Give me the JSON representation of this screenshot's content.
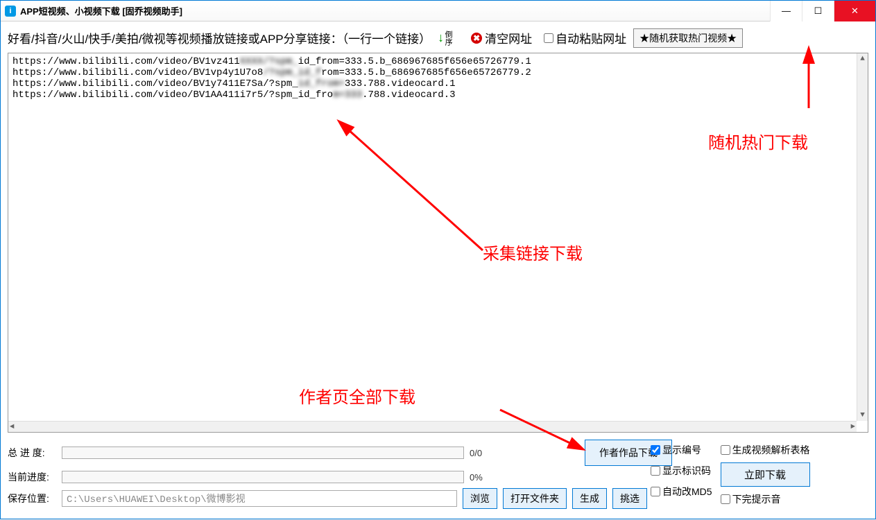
{
  "window": {
    "title": "APP短视频、小视频下载 [固乔视频助手]",
    "icon_letter": "i"
  },
  "toolbar": {
    "instruction": "好看/抖音/火山/快手/美拍/微视等视频播放链接或APP分享链接：（一行一个链接）",
    "reverse_label": "倒序",
    "clear_label": "清空网址",
    "auto_paste_label": "自动粘贴网址",
    "random_hot_label": "★随机获取热门视频★"
  },
  "urls": {
    "line1a": "https://www.bilibili.com/video/BV1vz411",
    "line1b": "id_from=333.5.b_686967685f656e65726779.1",
    "line2a": "https://www.bilibili.com/video/BV1vp4y1U7o8",
    "line2b": "rom=333.5.b_686967685f656e65726779.2",
    "line3a": "https://www.bilibili.com/video/BV1y7411E7Sa/?spm_",
    "line3b": "333.788.videocard.1",
    "line4a": "https://www.bilibili.com/video/BV1AA411i7r5/?spm_id_fro",
    "line4b": ".788.videocard.3"
  },
  "progress": {
    "total_label": "总 进 度:",
    "total_text": "0/0",
    "current_label": "当前进度:",
    "current_text": "0%"
  },
  "save": {
    "label": "保存位置:",
    "path": "C:\\Users\\HUAWEI\\Desktop\\微博影视",
    "browse": "浏览",
    "open_folder": "打开文件夹",
    "generate": "生成",
    "select": "挑选"
  },
  "actions": {
    "author_works": "作者作品下载"
  },
  "options": {
    "show_number": "显示编号",
    "show_id": "显示标识码",
    "auto_md5": "自动改MD5",
    "gen_table": "生成视频解析表格",
    "download_now": "立即下载",
    "done_sound": "下完提示音"
  },
  "annotations": {
    "a1": "随机热门下载",
    "a2": "采集链接下载",
    "a3": "作者页全部下载"
  }
}
